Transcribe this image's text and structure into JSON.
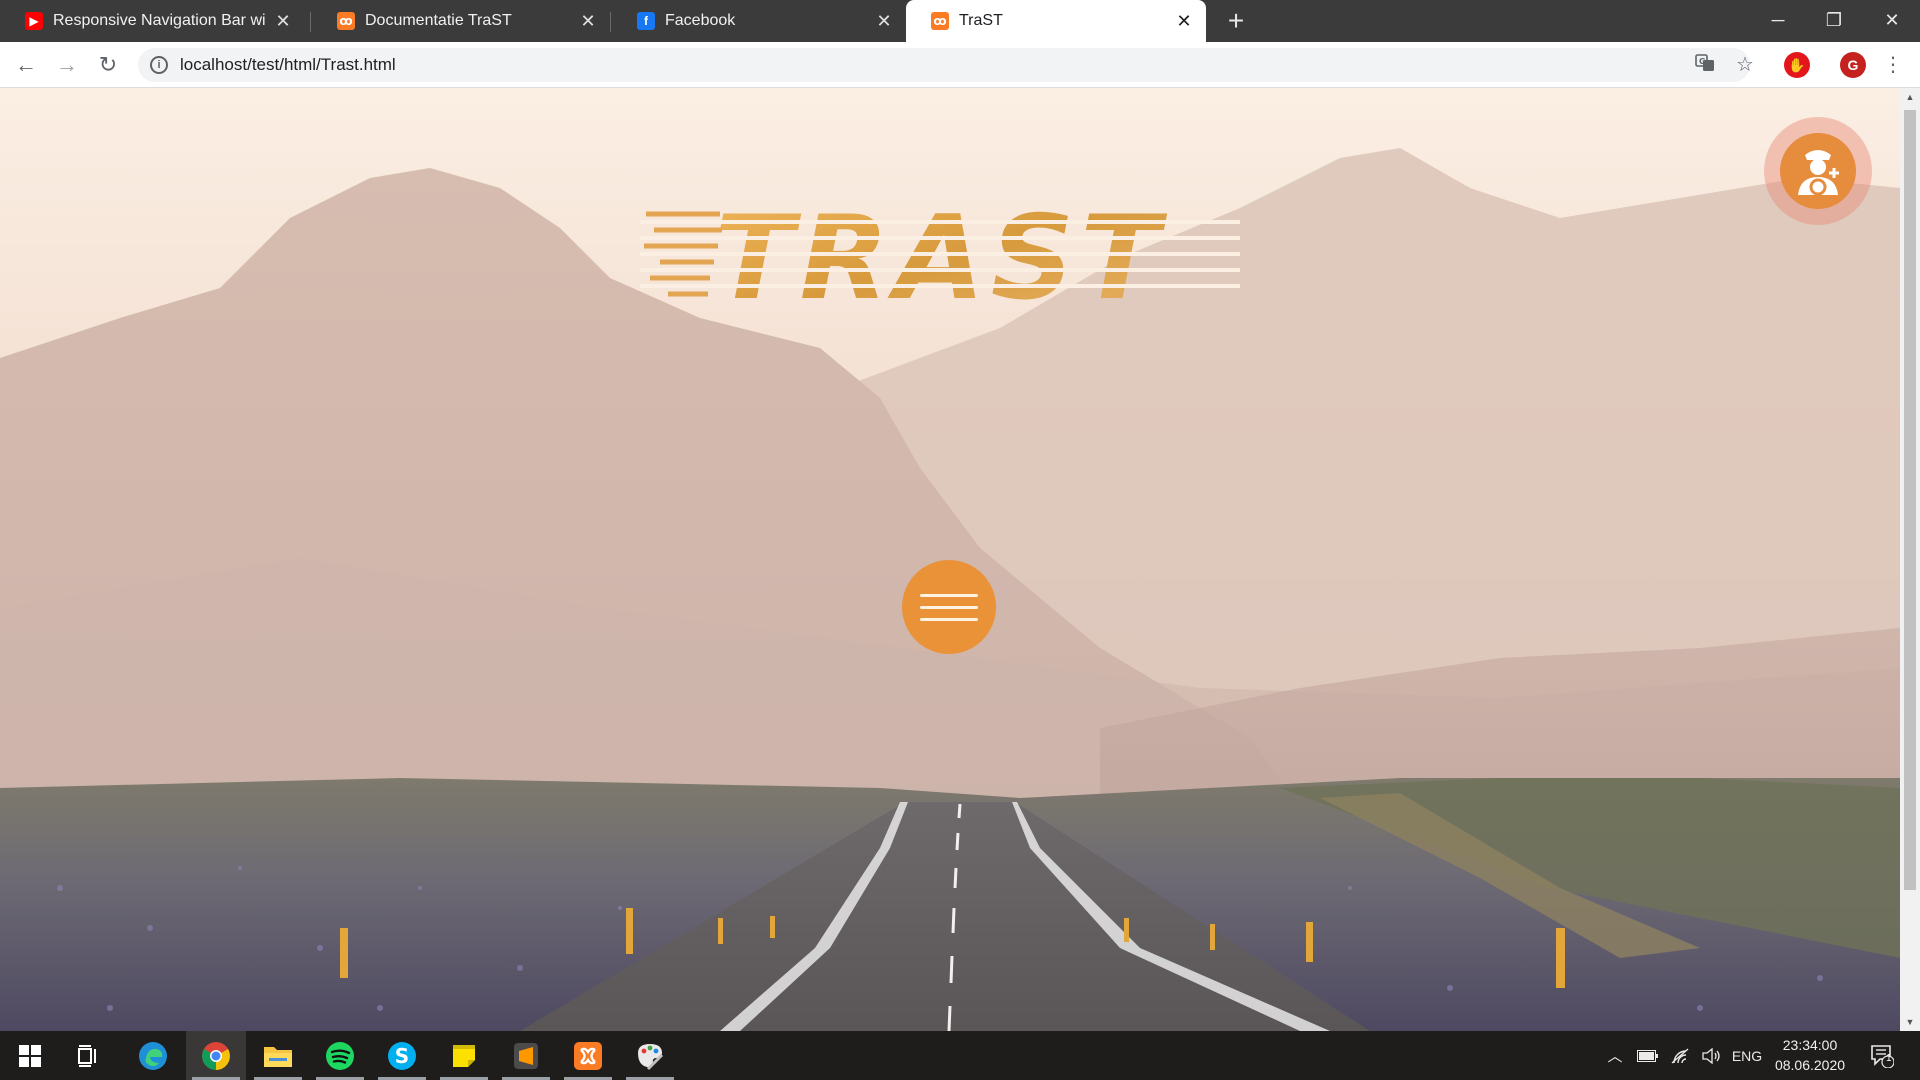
{
  "browser": {
    "tabs": [
      {
        "title": "Responsive Navigation Bar with H",
        "favicon": "youtube-icon",
        "active": false
      },
      {
        "title": "Documentatie TraST",
        "favicon": "xampp-icon",
        "active": false
      },
      {
        "title": "Facebook",
        "favicon": "facebook-icon",
        "active": false
      },
      {
        "title": "TraST",
        "favicon": "xampp-icon",
        "active": true
      }
    ],
    "new_tab": "+",
    "window_controls": {
      "minimize": "─",
      "restore": "❐",
      "close": "✕"
    },
    "toolbar": {
      "back": "←",
      "forward": "→",
      "reload": "↻",
      "url": "localhost/test/html/Trast.html",
      "translate_icon": "translate-icon",
      "bookmark_star": "☆",
      "profile_initial": "G"
    }
  },
  "page": {
    "logo_text": "TRAST",
    "user_button_icon": "driver-add-icon",
    "menu_button_icon": "hamburger-icon",
    "colors": {
      "accent": "#ea9238",
      "logo_gold": "#d99a3c",
      "sky": "#f6e6da"
    }
  },
  "taskbar": {
    "apps": [
      "start-icon",
      "task-view-icon",
      "edge-icon",
      "chrome-icon",
      "file-explorer-icon",
      "spotify-icon",
      "skype-icon",
      "sticky-notes-icon",
      "sublime-text-icon",
      "xampp-icon",
      "paint-icon"
    ],
    "language": "ENG",
    "time": "23:34:00",
    "date": "08.06.2020",
    "notifications_count": "1"
  }
}
